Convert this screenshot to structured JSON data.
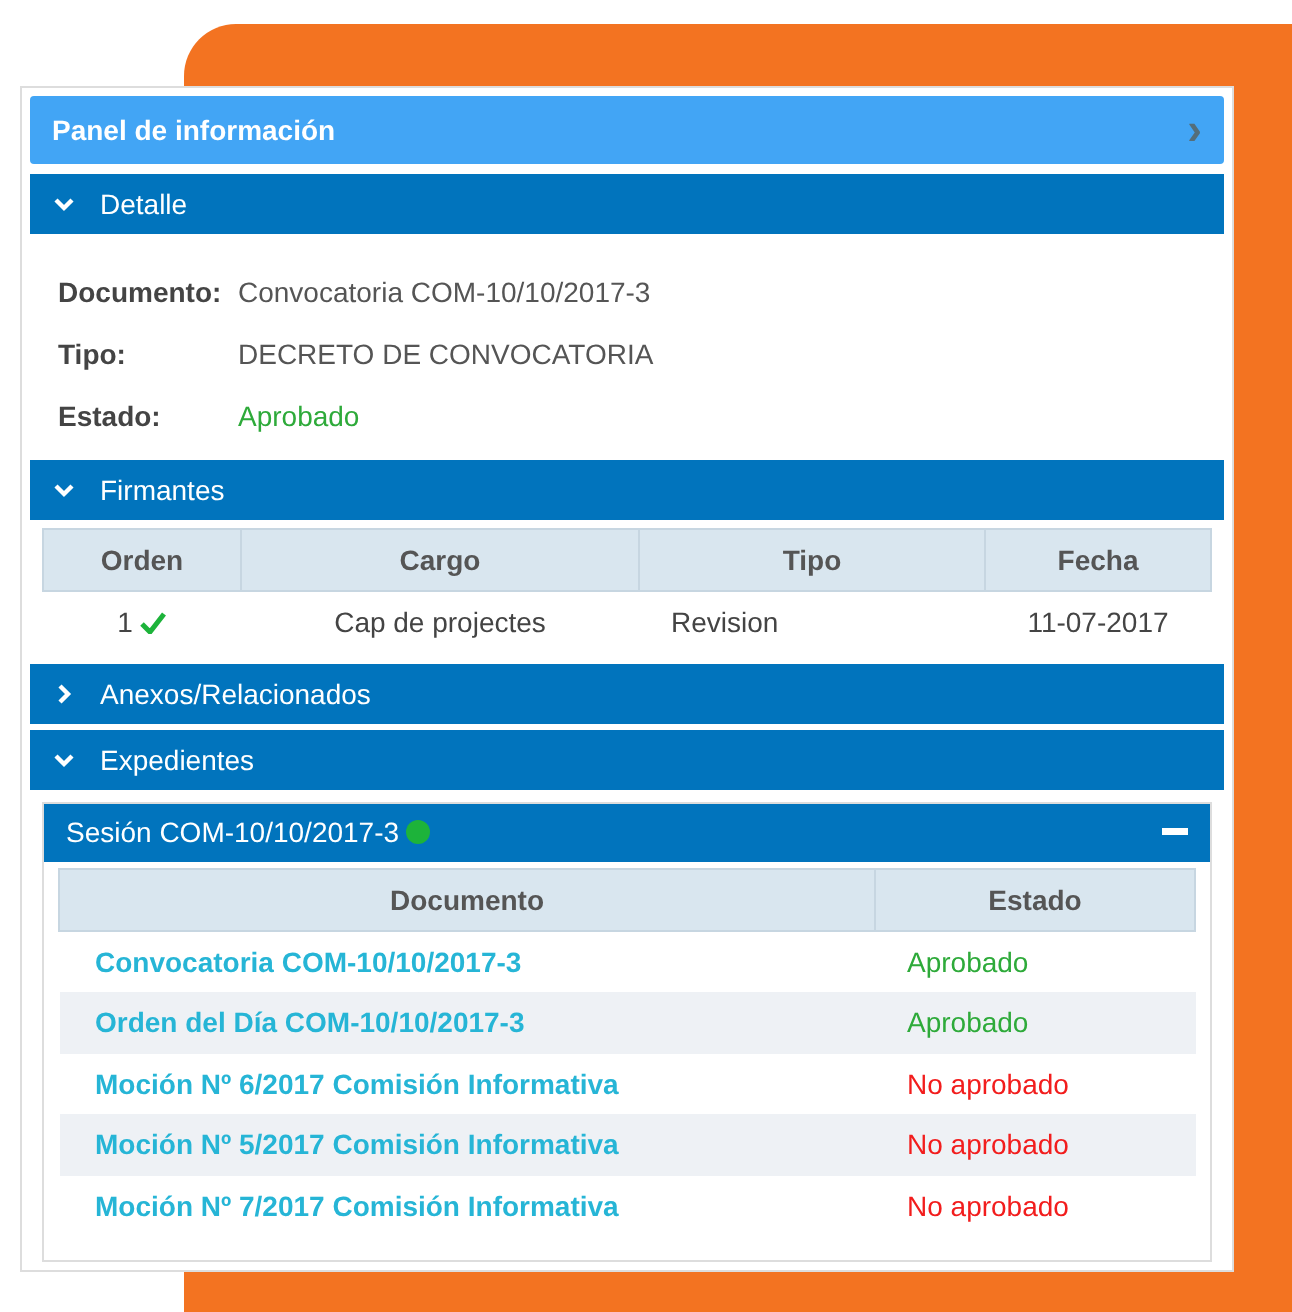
{
  "panel": {
    "title": "Panel de información",
    "chevron": "›"
  },
  "sections": [
    {
      "kind": "detail",
      "title": "Detalle",
      "expanded": true,
      "fields": [
        {
          "label": "Documento:",
          "value": "Convocatoria COM-10/10/2017-3",
          "kind": "plain"
        },
        {
          "label": "Tipo:",
          "value": "DECRETO DE CONVOCATORIA",
          "kind": "plain"
        },
        {
          "label": "Estado:",
          "value": "Aprobado",
          "kind": "approved"
        }
      ]
    },
    {
      "kind": "signers",
      "title": "Firmantes",
      "expanded": true,
      "columns": [
        "Orden",
        "Cargo",
        "Tipo",
        "Fecha"
      ],
      "rows": [
        {
          "orden": "1",
          "signed": true,
          "cargo": "Cap de projectes",
          "tipo": "Revision",
          "fecha": "11-07-2017"
        }
      ]
    },
    {
      "title": "Anexos/Relacionados",
      "expanded": false
    },
    {
      "kind": "files",
      "title": "Expedientes",
      "expanded": true,
      "session": {
        "title": "Sesión COM-10/10/2017-3",
        "color": "#1db33a",
        "expanded": true,
        "columns": [
          "Documento",
          "Estado"
        ],
        "rows": [
          {
            "documento": "Convocatoria COM-10/10/2017-3",
            "estado": "Aprobado",
            "kind": "approved"
          },
          {
            "documento": "Orden del Día COM-10/10/2017-3",
            "estado": "Aprobado",
            "kind": "approved"
          },
          {
            "documento": "Moción Nº 6/2017 Comisión Informativa",
            "estado": "No aprobado",
            "kind": "rejected"
          },
          {
            "documento": "Moción Nº 5/2017 Comisión Informativa",
            "estado": "No aprobado",
            "kind": "rejected"
          },
          {
            "documento": "Moción Nº 7/2017 Comisión Informativa",
            "estado": "No aprobado",
            "kind": "rejected"
          }
        ]
      }
    }
  ]
}
